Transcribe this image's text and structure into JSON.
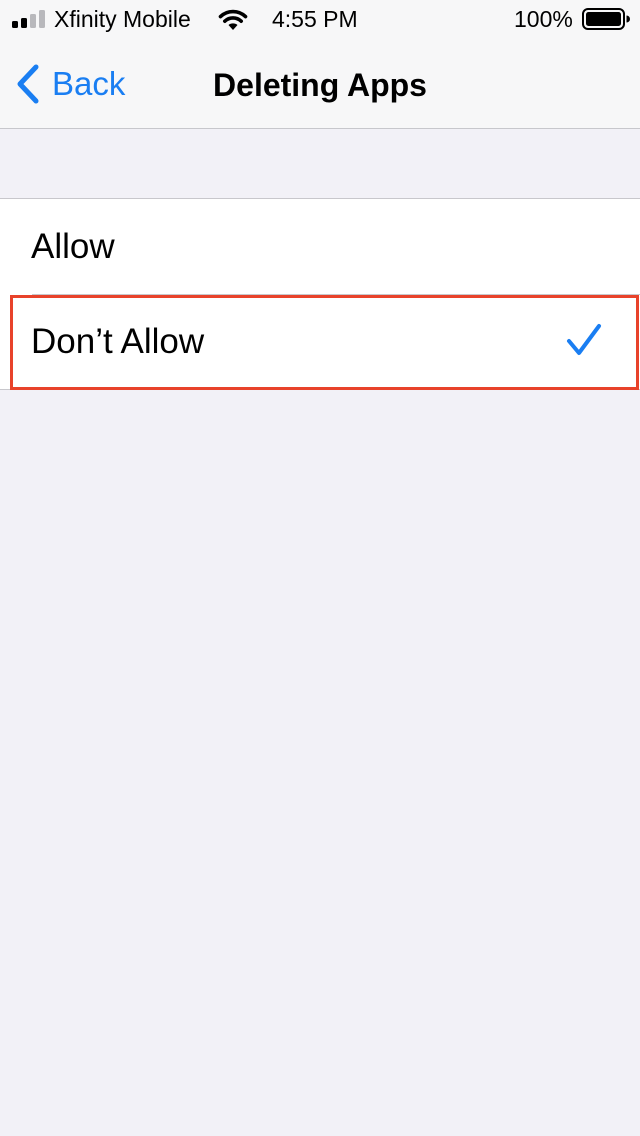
{
  "status_bar": {
    "carrier": "Xfinity Mobile",
    "time": "4:55 PM",
    "battery_percent": "100%",
    "signal_bars_filled": 2,
    "signal_bars_total": 4,
    "battery_level": 1.0
  },
  "nav": {
    "back_label": "Back",
    "title": "Deleting Apps"
  },
  "options": [
    {
      "label": "Allow",
      "selected": false
    },
    {
      "label": "Don’t Allow",
      "selected": true
    }
  ],
  "colors": {
    "accent": "#1a7ef2",
    "highlight": "#e8422a",
    "background": "#f2f1f7"
  },
  "icons": {
    "back": "chevron-left-icon",
    "check": "checkmark-icon",
    "wifi": "wifi-icon",
    "battery": "battery-icon",
    "signal": "cellular-signal-icon"
  }
}
